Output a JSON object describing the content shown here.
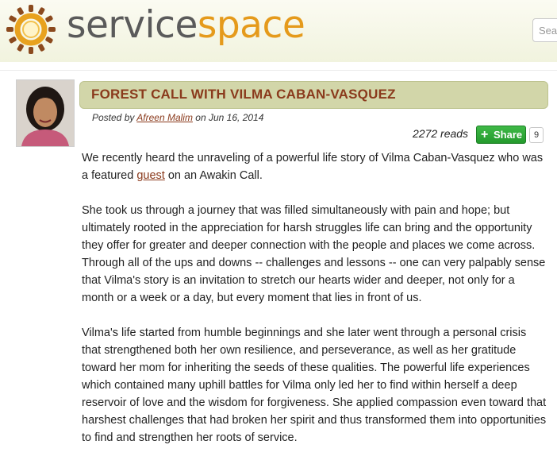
{
  "site": {
    "brand_part1": "service",
    "brand_part2": "space",
    "logo_icon": "sun-ring-logo-icon",
    "search_placeholder": "Sear",
    "colors": {
      "brand_gray": "#5a5a5a",
      "brand_orange": "#e59a1b",
      "title_bar": "#d2d6a9",
      "title_text": "#8a3a1c",
      "share_green": "#2aa833"
    }
  },
  "post": {
    "title": "FOREST CALL WITH VILMA CABAN-VASQUEZ",
    "posted_by_prefix": "Posted by",
    "author": "Afreen Malim",
    "date_prefix": "on",
    "date": "Jun 16, 2014",
    "reads": "2272 reads",
    "share_label": "Share",
    "share_count": "9",
    "avatar_alt": "author-photo"
  },
  "body": {
    "p1_before": "We recently heard the unraveling of a powerful life story of Vilma Caban-Vasquez who was a featured ",
    "p1_link": "guest",
    "p1_after": " on an Awakin Call.",
    "p2": "She took us through a journey that was filled simultaneously with pain and hope; but ultimately rooted in the appreciation for harsh struggles life can bring and the opportunity they offer for greater and deeper connection with the people and places we come across.  Through all of the ups and downs -- challenges and lessons -- one can very palpably sense that Vilma's story is an invitation to stretch our hearts wider and deeper, not only for a month or a week or a day, but every moment that lies in front of us.",
    "p3": "Vilma's life started from humble beginnings and she later went through a personal crisis that strengthened both her own resilience, and perseverance, as well as her gratitude toward her mom for inheriting the seeds of these qualities.  The powerful life experiences which contained many uphill battles for Vilma only led her to find within herself a deep reservoir of love and the wisdom for forgiveness. She applied compassion even toward that harshest challenges that had broken her spirit and thus transformed them into opportunities to find and strengthen her roots of service."
  }
}
